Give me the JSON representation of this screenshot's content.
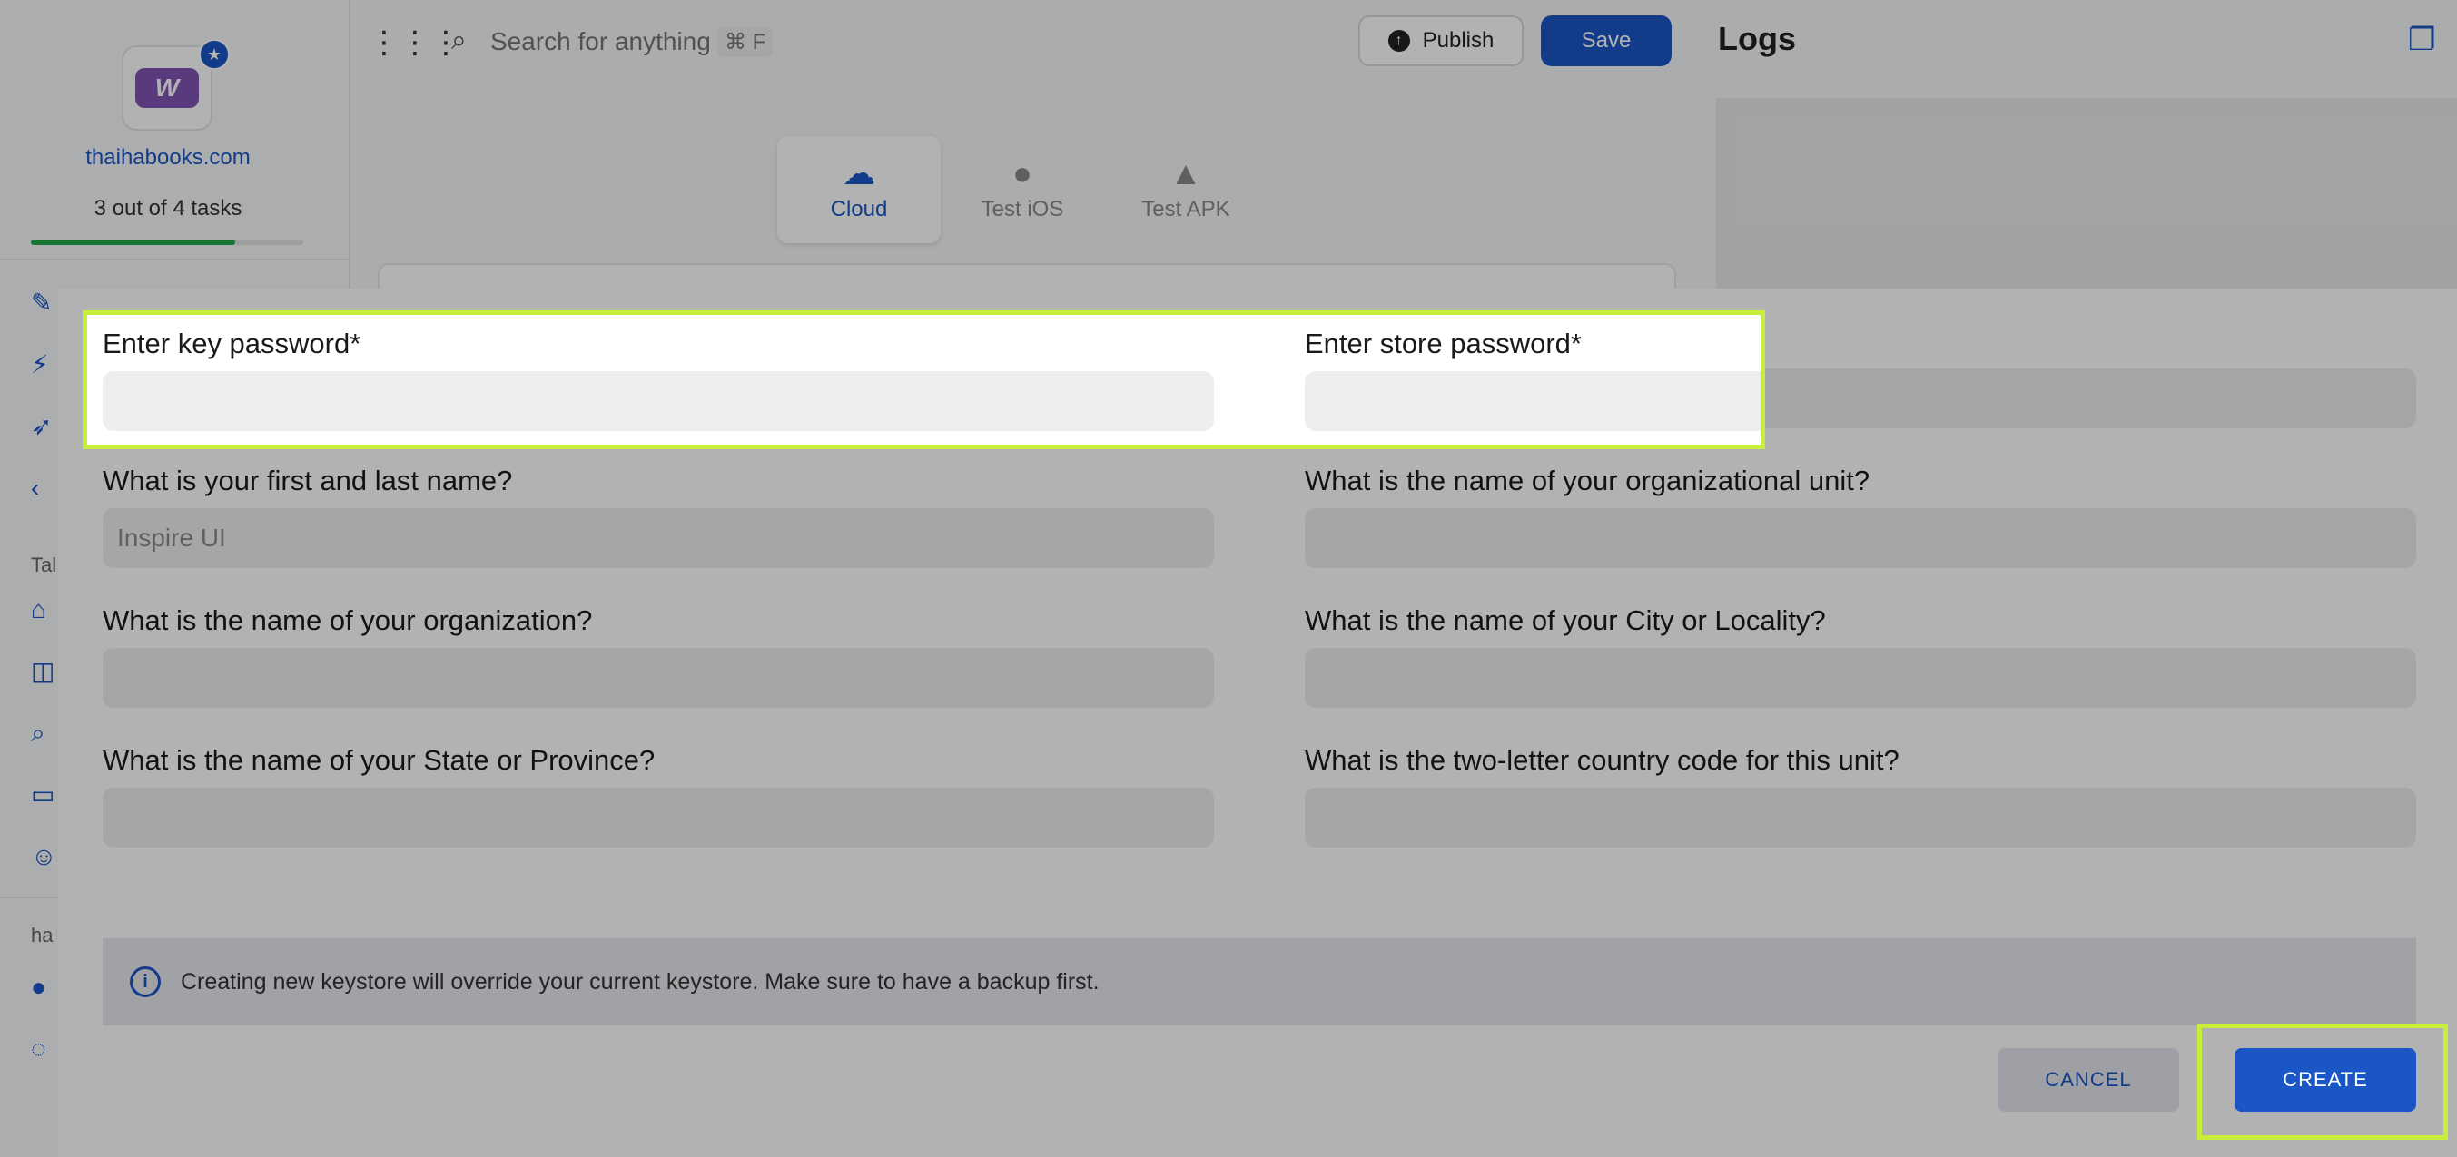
{
  "sidebar": {
    "site_name": "thaihabooks.com",
    "tasks": "3 out of 4 tasks",
    "tasks_progress": 0.75,
    "labels": [
      "Tal",
      "ha"
    ]
  },
  "toolbar": {
    "search_placeholder": "Search for anything",
    "search_shortcut": "⌘ F",
    "publish_label": "Publish",
    "save_label": "Save"
  },
  "logs": {
    "title": "Logs"
  },
  "build_tabs": [
    {
      "label": "Cloud",
      "active": true
    },
    {
      "label": "Test iOS",
      "active": false
    },
    {
      "label": "Test APK",
      "active": false
    }
  ],
  "dialog": {
    "fields": {
      "key_password": {
        "label": "Enter key password*",
        "value": ""
      },
      "store_password": {
        "label": "Enter store password*",
        "value": ""
      },
      "full_name": {
        "label": "What is your first and last name?",
        "placeholder": "Inspire UI"
      },
      "org_unit": {
        "label": "What is the name of your organizational unit?",
        "value": ""
      },
      "organization": {
        "label": "What is the name of your organization?",
        "value": ""
      },
      "city": {
        "label": "What is the name of your City or Locality?",
        "value": ""
      },
      "state": {
        "label": "What is the name of your State or Province?",
        "value": ""
      },
      "country_code": {
        "label": "What is the two-letter country code for this unit?",
        "value": ""
      }
    },
    "notice": "Creating new keystore will override your current keystore. Make sure to have a backup first.",
    "cancel_label": "CANCEL",
    "create_label": "CREATE"
  },
  "colors": {
    "accent": "#1a56c5",
    "highlight": "#c8ee3c"
  }
}
